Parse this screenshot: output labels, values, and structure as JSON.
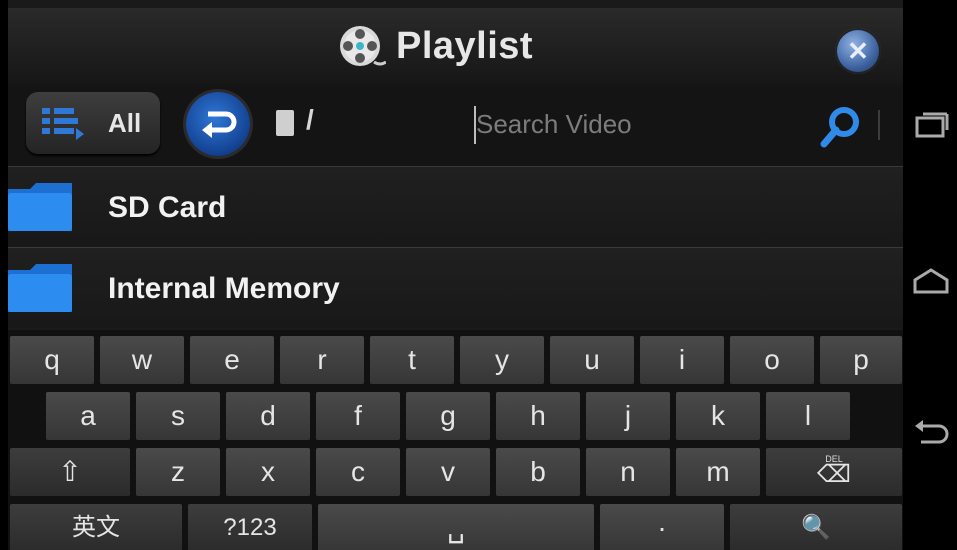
{
  "header": {
    "title": "Playlist",
    "close_icon_glyph": "✕"
  },
  "toolbar": {
    "all_label": "All",
    "path_text": "/",
    "search": {
      "placeholder": "Search Video",
      "value": ""
    }
  },
  "locations": [
    {
      "label": "SD Card",
      "icon": "folder-icon"
    },
    {
      "label": "Internal Memory",
      "icon": "folder-icon"
    }
  ],
  "keyboard": {
    "row1": [
      "q",
      "w",
      "e",
      "r",
      "t",
      "y",
      "u",
      "i",
      "o",
      "p"
    ],
    "row2": [
      "a",
      "s",
      "d",
      "f",
      "g",
      "h",
      "j",
      "k",
      "l"
    ],
    "row3": {
      "shift": "⇧",
      "letters": [
        "z",
        "x",
        "c",
        "v",
        "b",
        "n",
        "m"
      ],
      "del_label": "DEL",
      "del_glyph": "⌫"
    },
    "row4": {
      "lang": "英文",
      "symbols": "?123",
      "space": "␣",
      "period": "·",
      "search": "🔍"
    }
  },
  "colors": {
    "accent": "#2f78d6",
    "background": "#1a1a1a",
    "text": "#f2f2f2"
  }
}
